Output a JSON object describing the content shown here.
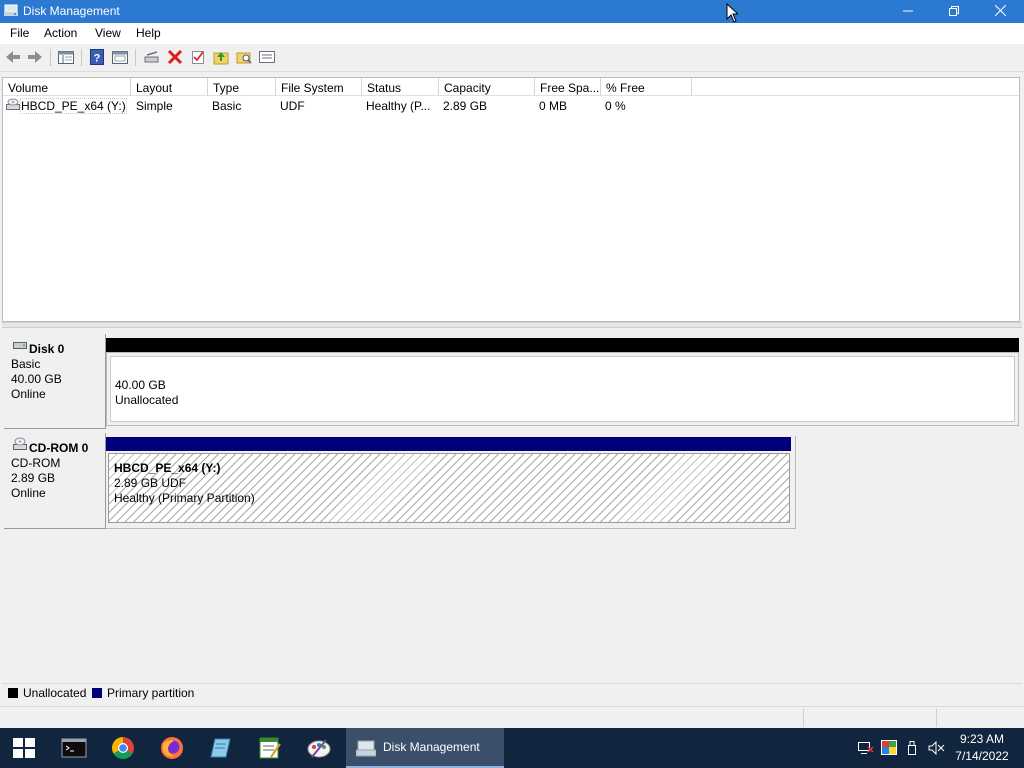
{
  "window": {
    "title": "Disk Management"
  },
  "menu": [
    "File",
    "Action",
    "View",
    "Help"
  ],
  "toolbar": {
    "icons": [
      "back-arrow-icon",
      "forward-arrow-icon",
      "console-tree-icon",
      "help-icon",
      "properties-icon",
      "connect-drive-icon",
      "delete-icon",
      "check-icon",
      "folder-up-icon",
      "search-folder-icon",
      "list-view-icon"
    ],
    "colors": {
      "delete": "#d81e1e"
    }
  },
  "volume_list": {
    "columns": [
      "Volume",
      "Layout",
      "Type",
      "File System",
      "Status",
      "Capacity",
      "Free Spa...",
      "% Free"
    ],
    "rows": [
      {
        "volume": "HBCD_PE_x64 (Y:)",
        "layout": "Simple",
        "type": "Basic",
        "file_system": "UDF",
        "status": "Healthy (P...",
        "capacity": "2.89 GB",
        "free_space": "0 MB",
        "pct_free": "0 %"
      }
    ]
  },
  "disks": [
    {
      "name": "Disk 0",
      "kind": "Basic",
      "size": "40.00 GB",
      "state": "Online",
      "partition": {
        "size": "40.00 GB",
        "label": "Unallocated",
        "bar_color": "#000000"
      }
    },
    {
      "name": "CD-ROM 0",
      "kind": "CD-ROM",
      "size": "2.89 GB",
      "state": "Online",
      "partition": {
        "title": "HBCD_PE_x64  (Y:)",
        "size": "2.89 GB UDF",
        "label": "Healthy (Primary Partition)",
        "bar_color": "#00007b"
      }
    }
  ],
  "legend": [
    {
      "label": "Unallocated",
      "color": "#000000"
    },
    {
      "label": "Primary partition",
      "color": "#00007b"
    }
  ],
  "taskbar": {
    "active_task": "Disk Management",
    "apps": [
      "start-icon",
      "terminal-icon",
      "chrome-icon",
      "firefox-icon",
      "notepad-icon",
      "text-editor-icon",
      "paint-icon"
    ],
    "clock": {
      "time": "9:23 AM",
      "date": "7/14/2022"
    },
    "tray": [
      "network-icon",
      "color-icon",
      "usb-icon",
      "volume-muted-icon"
    ]
  }
}
